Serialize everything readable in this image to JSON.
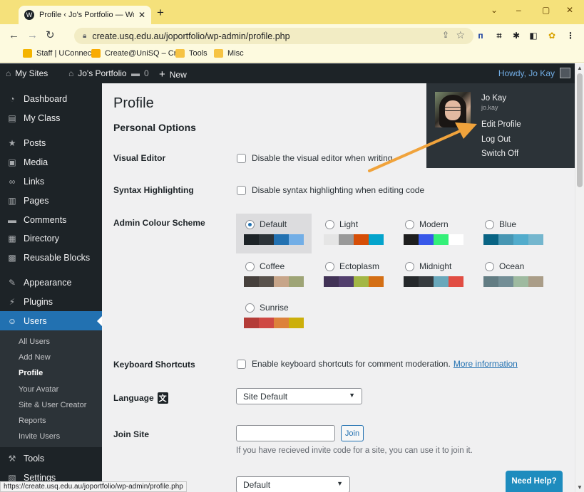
{
  "browser": {
    "tab_title": "Profile ‹ Jo's Portfolio — WordPre",
    "tab_close": "✕",
    "new_tab": "+",
    "url": "create.usq.edu.au/joportfolio/wp-admin/profile.php",
    "window_controls": [
      "⌄",
      "–",
      "▢",
      "✕"
    ],
    "bookmarks": [
      {
        "label": "Staff | UConnect",
        "icon_color": "#f4b400"
      },
      {
        "label": "Create@UniSQ – Cr...",
        "icon_color": "#f9ab00"
      },
      {
        "label": "Tools",
        "icon_color": "#f6c343"
      },
      {
        "label": "Misc",
        "icon_color": "#f6c343"
      }
    ],
    "status_url": "https://create.usq.edu.au/joportfolio/wp-admin/profile.php"
  },
  "adminbar": {
    "my_sites": "My Sites",
    "site_name": "Jo's Portfolio",
    "comments_count": "0",
    "new_label": "New",
    "howdy": "Howdy, Jo Kay"
  },
  "sidebar": {
    "items": [
      {
        "label": "Dashboard",
        "icon": "dashboard-icon",
        "glyph": "◔"
      },
      {
        "label": "My Class",
        "icon": "class-icon",
        "glyph": "▤"
      },
      {
        "label": "Posts",
        "icon": "pin-icon",
        "glyph": "★"
      },
      {
        "label": "Media",
        "icon": "media-icon",
        "glyph": "▣"
      },
      {
        "label": "Links",
        "icon": "links-icon",
        "glyph": "∞"
      },
      {
        "label": "Pages",
        "icon": "pages-icon",
        "glyph": "▥"
      },
      {
        "label": "Comments",
        "icon": "comments-icon",
        "glyph": "▬"
      },
      {
        "label": "Directory",
        "icon": "directory-icon",
        "glyph": "▦"
      },
      {
        "label": "Reusable Blocks",
        "icon": "blocks-icon",
        "glyph": "▩"
      },
      {
        "label": "Appearance",
        "icon": "appearance-icon",
        "glyph": "✎"
      },
      {
        "label": "Plugins",
        "icon": "plugins-icon",
        "glyph": "⚡"
      },
      {
        "label": "Users",
        "icon": "users-icon",
        "glyph": "☺"
      },
      {
        "label": "Tools",
        "icon": "tools-icon",
        "glyph": "⚒"
      },
      {
        "label": "Settings",
        "icon": "settings-icon",
        "glyph": "▧"
      }
    ],
    "current": "Users",
    "submenu": [
      "All Users",
      "Add New",
      "Profile",
      "Your Avatar",
      "Site & User Creator",
      "Reports",
      "Invite Users"
    ],
    "submenu_current": "Profile"
  },
  "main": {
    "title": "Profile",
    "section_title": "Personal Options",
    "visual_editor": {
      "label": "Visual Editor",
      "checkbox": "Disable the visual editor when writing"
    },
    "syntax": {
      "label": "Syntax Highlighting",
      "checkbox": "Disable syntax highlighting when editing code"
    },
    "colour_scheme": {
      "label": "Admin Colour Scheme",
      "selected": "Default",
      "schemes": [
        {
          "name": "Default",
          "colors": [
            "#1d2327",
            "#2c3338",
            "#2271b1",
            "#72aee6"
          ]
        },
        {
          "name": "Light",
          "colors": [
            "#e5e5e5",
            "#999999",
            "#d64e07",
            "#04a4cc"
          ]
        },
        {
          "name": "Modern",
          "colors": [
            "#1e1e1e",
            "#3858e9",
            "#33f078",
            "#ffffff"
          ]
        },
        {
          "name": "Blue",
          "colors": [
            "#096484",
            "#4796b3",
            "#52accc",
            "#74b6ce"
          ]
        },
        {
          "name": "Coffee",
          "colors": [
            "#46403c",
            "#59524c",
            "#c7a589",
            "#9ea476"
          ]
        },
        {
          "name": "Ectoplasm",
          "colors": [
            "#413256",
            "#523f6d",
            "#a3b745",
            "#d46f15"
          ]
        },
        {
          "name": "Midnight",
          "colors": [
            "#25282b",
            "#363b3f",
            "#69a8bb",
            "#e14d43"
          ]
        },
        {
          "name": "Ocean",
          "colors": [
            "#627c83",
            "#738e96",
            "#9ebaa0",
            "#aa9d88"
          ]
        },
        {
          "name": "Sunrise",
          "colors": [
            "#b43c38",
            "#cf4944",
            "#dd823b",
            "#ccaf0b"
          ]
        }
      ]
    },
    "keyboard": {
      "label": "Keyboard Shortcuts",
      "checkbox": "Enable keyboard shortcuts for comment moderation.",
      "link": "More information"
    },
    "language": {
      "label": "Language",
      "value": "Site Default"
    },
    "join_site": {
      "label": "Join Site",
      "button": "Join",
      "description": "If you have recieved invite code for a site, you can use it to join it."
    },
    "bottom_select": "Default"
  },
  "dropdown": {
    "name": "Jo Kay",
    "username": "jo.kay",
    "links": [
      "Edit Profile",
      "Log Out",
      "Switch Off"
    ]
  },
  "help": {
    "label": "Need Help?"
  },
  "colors": {
    "accent": "#2271b1",
    "annotation_arrow": "#f0a33c"
  }
}
